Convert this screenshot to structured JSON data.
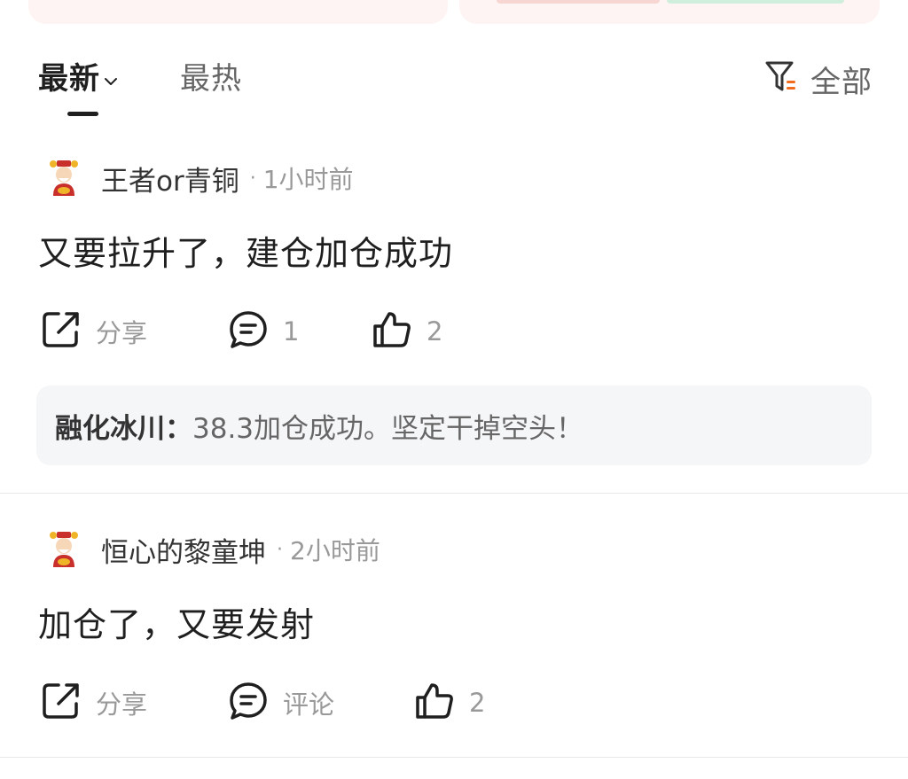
{
  "tabs": {
    "latest_label": "最新",
    "hot_label": "最热",
    "filter_label": "全部"
  },
  "comments": [
    {
      "username": "王者or青铜",
      "separator": "·",
      "time": "1小时前",
      "content": "又要拉升了，建仓加仓成功",
      "share_label": "分享",
      "comment_label": "1",
      "like_count": "2",
      "reply": {
        "name": "融化冰川：",
        "text": "38.3加仓成功。坚定干掉空头！"
      }
    },
    {
      "username": "恒心的黎童坤",
      "separator": "·",
      "time": "2小时前",
      "content": "加仓了，又要发射",
      "share_label": "分享",
      "comment_label": "评论",
      "like_count": "2"
    }
  ],
  "colors": {
    "accent_orange": "#f26b1d",
    "text_primary": "#1f1f1f",
    "text_secondary": "#999999",
    "reply_bg": "#f5f6f8"
  }
}
